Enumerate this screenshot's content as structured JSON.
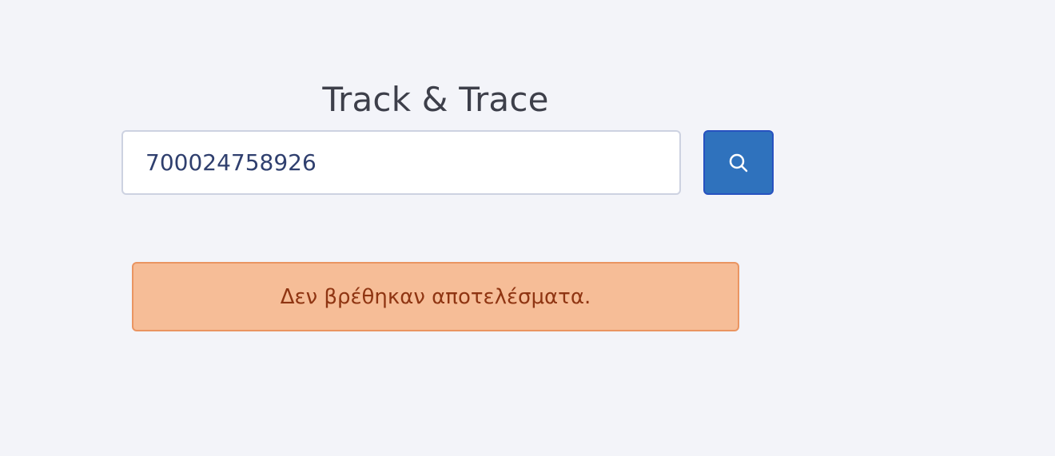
{
  "header": {
    "title": "Track & Trace"
  },
  "search": {
    "value": "700024758926",
    "button_icon": "search-icon"
  },
  "alert": {
    "message": "Δεν βρέθηκαν αποτελέσματα."
  },
  "colors": {
    "background": "#f3f4f9",
    "button_primary": "#2f72bd",
    "alert_background": "#f6bd97",
    "alert_border": "#ea9562",
    "alert_text": "#8f3512",
    "input_text": "#2f3f6e",
    "title_text": "#3d3f4a"
  }
}
